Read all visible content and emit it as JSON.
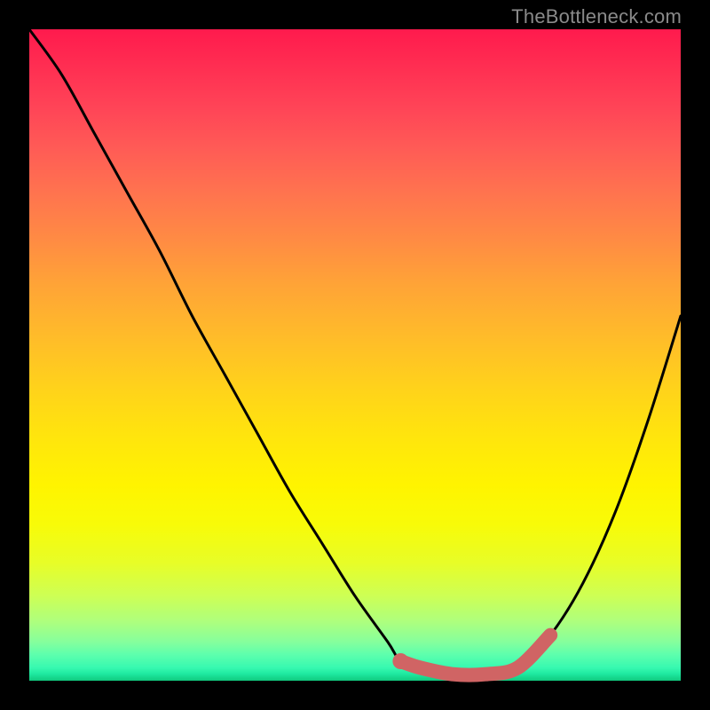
{
  "watermark": "TheBottleneck.com",
  "colors": {
    "page_bg": "#000000",
    "curve": "#000000",
    "highlight": "#d06464",
    "watermark": "#8a8a8a"
  },
  "chart_data": {
    "type": "line",
    "title": "",
    "xlabel": "",
    "ylabel": "",
    "xlim": [
      0,
      100
    ],
    "ylim": [
      0,
      100
    ],
    "grid": false,
    "legend": false,
    "series": [
      {
        "name": "bottleneck-curve",
        "x": [
          0,
          5,
          10,
          15,
          20,
          25,
          30,
          35,
          40,
          45,
          50,
          55,
          57,
          60,
          65,
          70,
          75,
          80,
          85,
          90,
          95,
          100
        ],
        "values": [
          100,
          93,
          84,
          75,
          66,
          56,
          47,
          38,
          29,
          21,
          13,
          6,
          3,
          2,
          1,
          1,
          2,
          7,
          15,
          26,
          40,
          56
        ]
      }
    ],
    "annotations": [
      {
        "name": "sweet-spot-highlight",
        "type": "segment",
        "x": [
          57,
          60,
          65,
          70,
          75,
          80
        ],
        "values": [
          3,
          2,
          1,
          1,
          2,
          7
        ],
        "color": "#d06464"
      },
      {
        "name": "sweet-spot-marker",
        "type": "point",
        "x": 57,
        "value": 3,
        "color": "#d06464"
      }
    ],
    "gradient_stops": [
      {
        "pos": 0,
        "color": "#ff1a4d"
      },
      {
        "pos": 25,
        "color": "#ff734f"
      },
      {
        "pos": 55,
        "color": "#ffd21b"
      },
      {
        "pos": 76,
        "color": "#f8fb08"
      },
      {
        "pos": 94,
        "color": "#86ff9c"
      },
      {
        "pos": 100,
        "color": "#11c97e"
      }
    ]
  }
}
